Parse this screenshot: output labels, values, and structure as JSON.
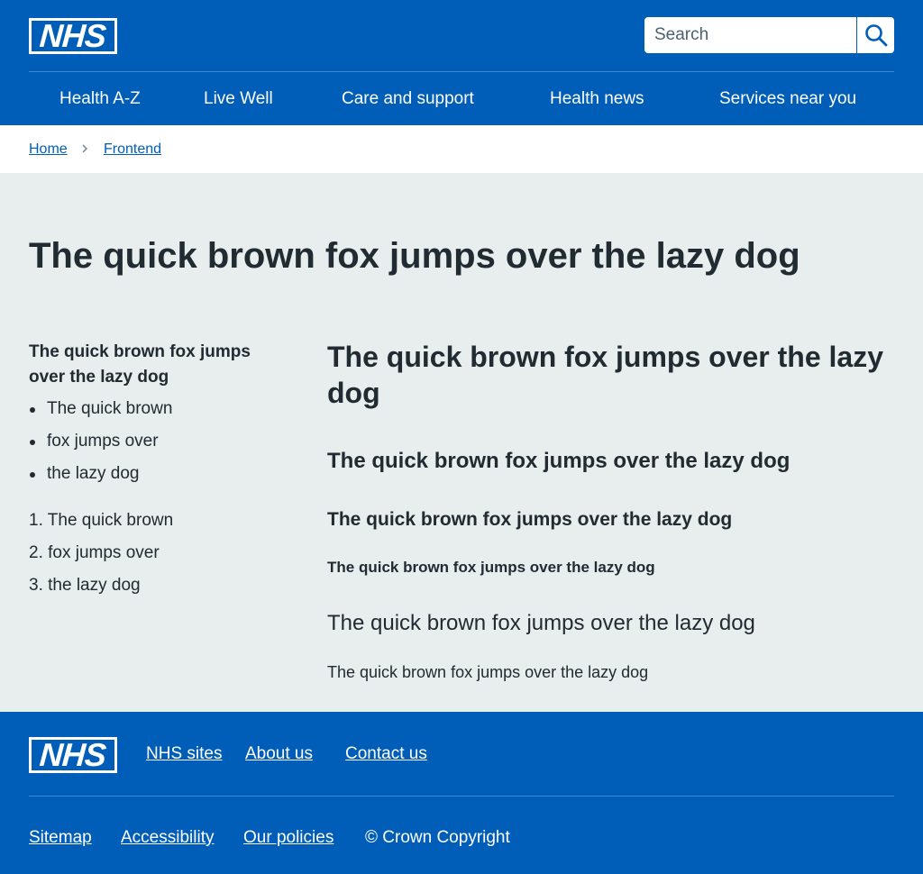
{
  "header": {
    "logo_text": "NHS",
    "search_placeholder": "Search",
    "search_icon": "search-icon",
    "nav": [
      {
        "label": "Health A-Z"
      },
      {
        "label": "Live Well"
      },
      {
        "label": "Care and support"
      },
      {
        "label": "Health news"
      },
      {
        "label": "Services near you"
      }
    ]
  },
  "breadcrumb": {
    "items": [
      {
        "label": "Home"
      },
      {
        "label": "Frontend"
      }
    ],
    "separator_icon": "chevron-right-icon"
  },
  "main": {
    "title": "The quick brown fox jumps over the lazy dog",
    "side_heading": "The quick brown fox jumps over the lazy dog",
    "bullet_list": [
      "The quick brown",
      "fox jumps over",
      "the lazy dog"
    ],
    "numbered_list": [
      "1. The quick brown",
      "2. fox jumps over",
      "3. the lazy dog"
    ],
    "heading_xl": "The quick brown fox jumps over the lazy dog",
    "heading_l": "The quick brown fox jumps over the lazy dog",
    "heading_m": "The quick brown fox jumps over the lazy dog",
    "heading_s": "The quick brown fox jumps over the lazy dog",
    "lede": "The quick brown fox jumps over the lazy dog",
    "body": "The quick brown fox jumps over the lazy dog"
  },
  "footer": {
    "logo_text": "NHS",
    "primary_links": [
      "NHS sites",
      "About us",
      "Contact us"
    ],
    "secondary_links": [
      "Sitemap",
      "Accessibility",
      "Our policies"
    ],
    "copyright": "© Crown Copyright"
  },
  "colors": {
    "nhs_blue": "#005eb8",
    "text": "#212b32",
    "page_background": "#e8edee",
    "link": "#005eb8"
  }
}
